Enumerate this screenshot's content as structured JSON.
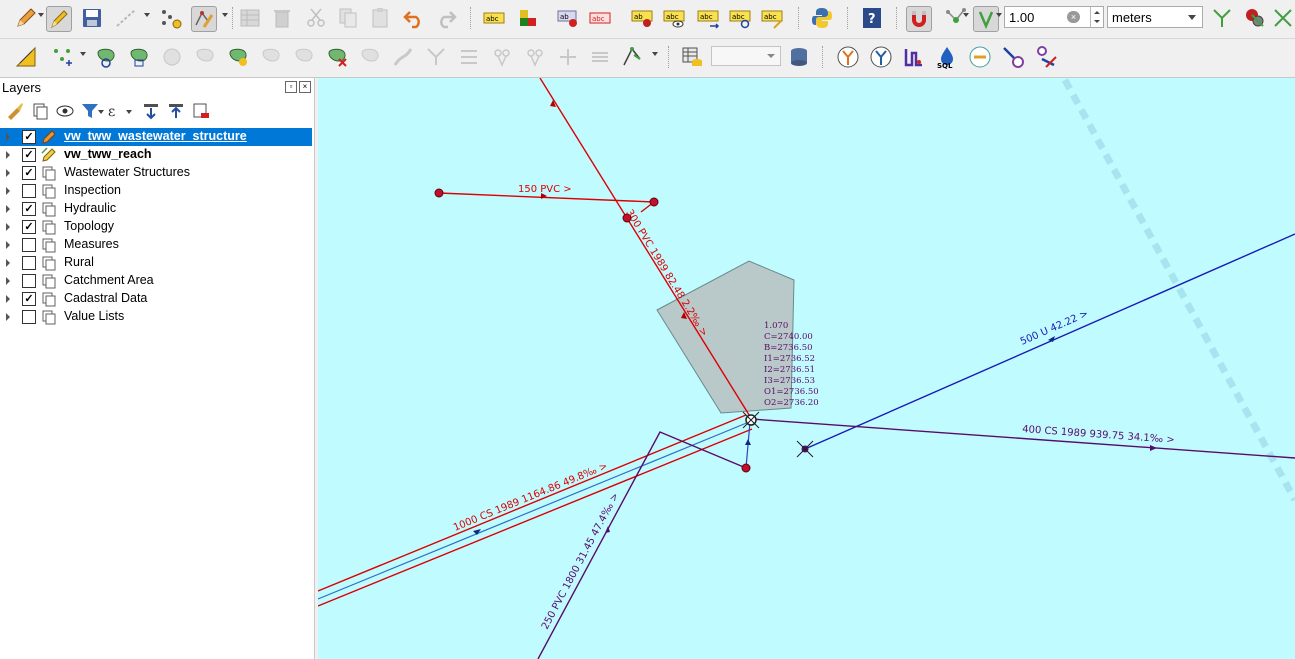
{
  "toolbar": {
    "snap_tolerance": "1.00",
    "snap_units": "meters",
    "scale_combo": ""
  },
  "layers_panel": {
    "title": "Layers",
    "items": [
      {
        "name": "vw_tww_wastewater_structure",
        "checked": true,
        "selected": true,
        "bold": true,
        "icon": "pencil-icon"
      },
      {
        "name": "vw_tww_reach",
        "checked": true,
        "selected": false,
        "bold": true,
        "icon": "pencil-icon"
      },
      {
        "name": "Wastewater Structures",
        "checked": true,
        "selected": false,
        "bold": false,
        "icon": "group-icon"
      },
      {
        "name": "Inspection",
        "checked": false,
        "selected": false,
        "bold": false,
        "icon": "group-icon"
      },
      {
        "name": "Hydraulic",
        "checked": true,
        "selected": false,
        "bold": false,
        "icon": "group-icon"
      },
      {
        "name": "Topology",
        "checked": true,
        "selected": false,
        "bold": false,
        "icon": "group-icon"
      },
      {
        "name": "Measures",
        "checked": false,
        "selected": false,
        "bold": false,
        "icon": "group-icon"
      },
      {
        "name": "Rural",
        "checked": false,
        "selected": false,
        "bold": false,
        "icon": "group-icon"
      },
      {
        "name": "Catchment Area",
        "checked": false,
        "selected": false,
        "bold": false,
        "icon": "group-icon"
      },
      {
        "name": "Cadastral Data",
        "checked": true,
        "selected": false,
        "bold": false,
        "icon": "group-icon"
      },
      {
        "name": "Value Lists",
        "checked": false,
        "selected": false,
        "bold": false,
        "icon": "group-icon"
      }
    ]
  },
  "map": {
    "colors": {
      "background": "#c0fcff",
      "red_reach": "#dd0000",
      "blue_reach": "#1a1ab8",
      "purple_reach": "#5a0a6a",
      "polygon": "#b9c8c9",
      "node": "#c0102a",
      "label_purple": "#5a0a6a"
    },
    "labels": {
      "reach_150": "150 PVC >",
      "reach_300": "300 PVC 1989 82.48 2.2‰ >",
      "reach_500": "500 U 42.22 >",
      "reach_400": "400 CS 1989 939.75 34.1‰ >",
      "reach_1000": "1000 CS 1989 1164.86 49.8‰ >",
      "reach_250": "250 PVC 1800 31.45 47.4‰ >"
    },
    "structure_label": [
      "1.070",
      "C=2740.00",
      "B=2736.50",
      "I1=2736.52",
      "I2=2736.51",
      "I3=2736.53",
      "O1=2736.50",
      "O2=2736.20"
    ]
  }
}
